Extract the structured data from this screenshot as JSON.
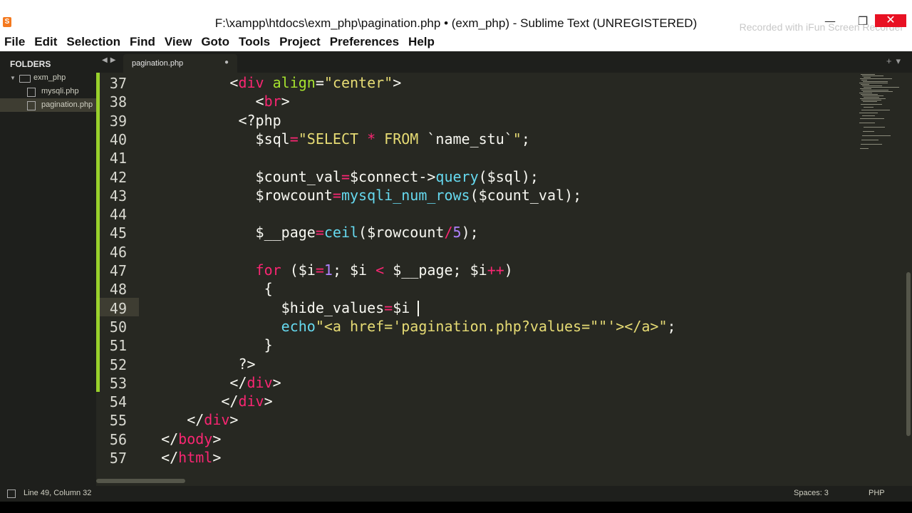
{
  "window": {
    "title": "F:\\xampp\\htdocs\\exm_php\\pagination.php • (exm_php) - Sublime Text (UNREGISTERED)",
    "watermark": "Recorded with iFun Screen Recorder",
    "close_glyph": "✕",
    "minimize_glyph": "—",
    "maximize_glyph": "❐"
  },
  "menu": [
    "File",
    "Edit",
    "Selection",
    "Find",
    "View",
    "Goto",
    "Tools",
    "Project",
    "Preferences",
    "Help"
  ],
  "sidebar": {
    "heading": "FOLDERS",
    "folder": "exm_php",
    "files": [
      "mysqli.php",
      "pagination.php"
    ]
  },
  "tabs": {
    "active": "pagination.php",
    "dirty_marker": "●"
  },
  "editor": {
    "line_numbers": [
      "37",
      "38",
      "39",
      "40",
      "41",
      "42",
      "43",
      "44",
      "45",
      "46",
      "47",
      "48",
      "49",
      "50",
      "51",
      "52",
      "53",
      "54",
      "55",
      "56",
      "57"
    ],
    "current_line": "49"
  },
  "status": {
    "position": "Line 49, Column 32",
    "spaces": "Spaces: 3",
    "syntax": "PHP"
  },
  "colors": {
    "bg": "#272822",
    "tag": "#f92672",
    "attr": "#a6e22e",
    "string": "#e6db74",
    "function": "#66d9ef",
    "number": "#ae81ff"
  }
}
